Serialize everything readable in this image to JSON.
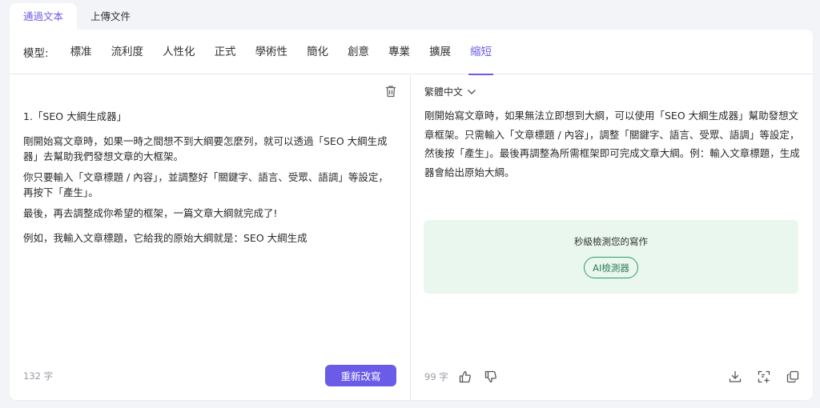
{
  "tabs": [
    "通過文本",
    "上傳文件"
  ],
  "mode": {
    "label": "模型:",
    "items": [
      "標准",
      "流利度",
      "人性化",
      "正式",
      "學術性",
      "簡化",
      "創意",
      "專業",
      "擴展",
      "縮短"
    ],
    "active": "縮短"
  },
  "input": {
    "paragraphs": [
      "1.「SEO 大綱生成器」",
      "剛開始寫文章時，如果一時之間想不到大綱要怎麼列，就可以透過「SEO 大綱生成器」去幫助我們發想文章的大框架。",
      "你只要輸入「文章標題 / 內容」，並調整好「關鍵字、語言、受眾、語調」等設定，再按下「產生」。",
      "最後，再去調整成你希望的框架，一篇文章大綱就完成了!",
      "例如，我輸入文章標題，它給我的原始大綱就是：SEO 大綱生成"
    ],
    "count": "132 字",
    "rewrite_button": "重新改寫"
  },
  "output": {
    "language": "繁體中文",
    "text": "剛開始寫文章時，如果無法立即想到大綱，可以使用「SEO 大綱生成器」幫助發想文章框架。只需輸入「文章標題 / 內容」，調整「關鍵字、語言、受眾、語調」等設定，然後按「產生」。最後再調整為所需框架即可完成文章大綱。例：輸入文章標題，生成器會給出原始大綱。",
    "detect_title": "秒級檢測您的寫作",
    "detect_button": "AI檢測器",
    "count": "99 字"
  },
  "colors": {
    "accent": "#6b5ce7",
    "detect_bg": "#e9f7ef",
    "detect_border": "#2e9a6c"
  },
  "icons": [
    "trash-icon",
    "chevron-down-icon",
    "thumbs-up-icon",
    "thumbs-down-icon",
    "download-icon",
    "add-frame-icon",
    "copy-icon"
  ]
}
